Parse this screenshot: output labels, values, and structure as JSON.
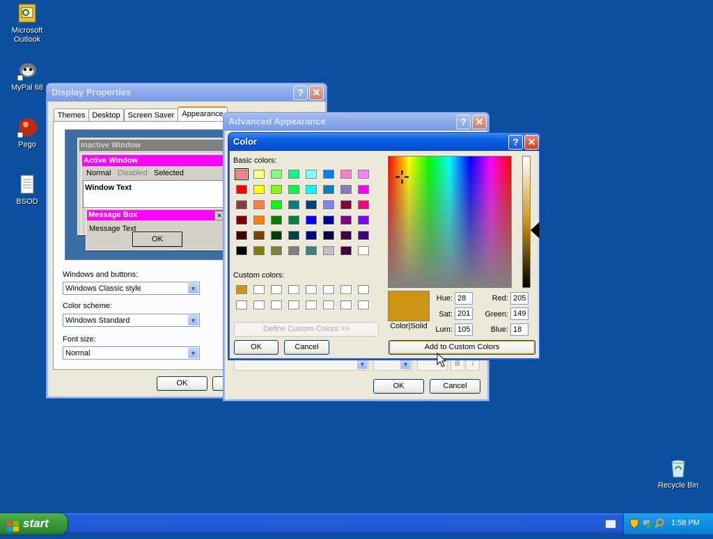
{
  "desktop": {
    "icons": [
      {
        "label": "Microsoft Outlook"
      },
      {
        "label": "MyPal 68"
      },
      {
        "label": "Pego"
      },
      {
        "label": "BSOD"
      },
      {
        "label": "Recycle Bin"
      }
    ]
  },
  "display_properties": {
    "title": "Display Properties",
    "tabs": [
      "Themes",
      "Desktop",
      "Screen Saver",
      "Appearance"
    ],
    "preview": {
      "inactive_title": "Inactive Window",
      "active_title": "Active Window",
      "menu_normal": "Normal",
      "menu_disabled": "Disabled",
      "menu_selected": "Selected",
      "window_text": "Window Text",
      "msgbox_title": "Message Box",
      "msgbox_text": "Message Text",
      "ok": "OK"
    },
    "windows_buttons_label": "Windows and buttons:",
    "windows_buttons_value": "Windows Classic style",
    "color_scheme_label": "Color scheme:",
    "color_scheme_value": "Windows Standard",
    "font_size_label": "Font size:",
    "font_size_value": "Normal",
    "ok": "OK"
  },
  "advanced": {
    "title": "Advanced Appearance",
    "bold": "B",
    "italic": "I",
    "ok": "OK",
    "cancel": "Cancel"
  },
  "color_dialog": {
    "title": "Color",
    "help": "?",
    "close": "✕",
    "basic_label": "Basic colors:",
    "custom_label": "Custom colors:",
    "define_custom": "Define Custom Colors >>",
    "ok": "OK",
    "cancel": "Cancel",
    "color_solid": "Color|Solid",
    "hue_label": "Hue:",
    "hue": "28",
    "sat_label": "Sat:",
    "sat": "201",
    "lum_label": "Lum:",
    "lum": "105",
    "red_label": "Red:",
    "red": "205",
    "green_label": "Green:",
    "green": "149",
    "blue_label": "Blue:",
    "blue": "18",
    "add_custom": "Add to Custom Colors",
    "current_color": "#cd9512",
    "basic_colors": [
      "#ff8080",
      "#ffff80",
      "#80ff80",
      "#00ff80",
      "#80ffff",
      "#0080ff",
      "#ff80c0",
      "#ff80ff",
      "#ff0000",
      "#ffff00",
      "#80ff00",
      "#00ff40",
      "#00ffff",
      "#0080c0",
      "#8080c0",
      "#ff00ff",
      "#804040",
      "#ff8040",
      "#00ff00",
      "#008080",
      "#004080",
      "#8080ff",
      "#800040",
      "#ff0080",
      "#800000",
      "#ff8000",
      "#008000",
      "#008040",
      "#0000ff",
      "#0000a0",
      "#800080",
      "#8000ff",
      "#400000",
      "#804000",
      "#004000",
      "#004040",
      "#000080",
      "#000040",
      "#400040",
      "#400080",
      "#000000",
      "#808000",
      "#808040",
      "#808080",
      "#408080",
      "#c0c0c0",
      "#400040",
      "#ffffff"
    ],
    "custom_colors": [
      "#cd9512",
      "#ffffff",
      "#ffffff",
      "#ffffff",
      "#ffffff",
      "#ffffff",
      "#ffffff",
      "#ffffff",
      "#ffffff",
      "#ffffff",
      "#ffffff",
      "#ffffff",
      "#ffffff",
      "#ffffff",
      "#ffffff",
      "#ffffff"
    ]
  },
  "taskbar": {
    "start": "start",
    "clock": "1:58 PM"
  }
}
